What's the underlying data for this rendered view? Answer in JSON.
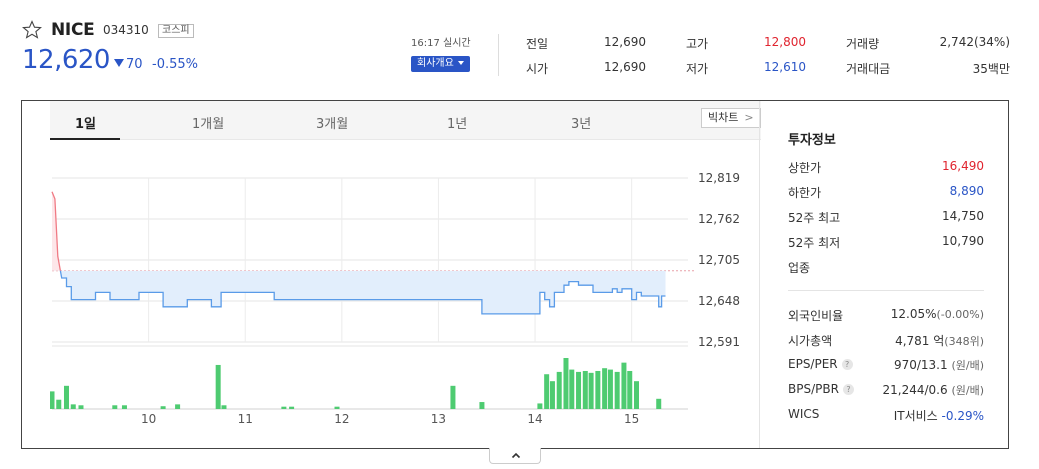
{
  "header": {
    "name": "NICE",
    "code": "034310",
    "market": "코스피",
    "price": "12,620",
    "change": "70",
    "change_pct": "-0.55%",
    "realtime": "16:17 실시간",
    "company_btn": "회사개요"
  },
  "stats": {
    "prev_label": "전일",
    "prev_value": "12,690",
    "open_label": "시가",
    "open_value": "12,690",
    "high_label": "고가",
    "high_value": "12,800",
    "low_label": "저가",
    "low_value": "12,610",
    "volume_label": "거래량",
    "volume_value": "2,742(34%)",
    "amount_label": "거래대금",
    "amount_value": "35백만"
  },
  "tabs": [
    "1일",
    "1개월",
    "3개월",
    "1년",
    "3년"
  ],
  "bigchart_label": "빅차트",
  "info": {
    "title": "투자정보",
    "upper_label": "상한가",
    "upper_value": "16,490",
    "lower_label": "하한가",
    "lower_value": "8,890",
    "high52_label": "52주 최고",
    "high52_value": "14,750",
    "low52_label": "52주 최저",
    "low52_value": "10,790",
    "sector_label": "업종",
    "foreign_label": "외국인비율",
    "foreign_value": "12.05%",
    "foreign_sub": "(-0.00%)",
    "mcap_label": "시가총액",
    "mcap_value": "4,781 억",
    "mcap_sub": "(348위)",
    "eps_label": "EPS/PER",
    "eps_value": "970/13.1",
    "eps_sub": "(원/배)",
    "bps_label": "BPS/PBR",
    "bps_value": "21,244/0.6",
    "bps_sub": "(원/배)",
    "wics_label": "WICS",
    "wics_value": "IT서비스",
    "wics_change": "-0.29%"
  },
  "colors": {
    "up": "#e0242f",
    "down": "#2a55c6",
    "volume": "#4ecb71",
    "line_below": "#5a9be8",
    "line_above": "#f07a84"
  },
  "chart_data": {
    "type": "line",
    "y_ticks": [
      "12,819",
      "12,762",
      "12,705",
      "12,648",
      "12,591"
    ],
    "x_ticks": [
      "10",
      "11",
      "12",
      "13",
      "14",
      "15"
    ],
    "ylim": [
      12591,
      12819
    ],
    "xlim": [
      9.0,
      15.583
    ],
    "prev_close": 12690,
    "price": {
      "t": [
        9.0,
        9.03,
        9.06,
        9.1,
        9.15,
        9.2,
        9.3,
        9.45,
        9.5,
        9.6,
        9.8,
        9.9,
        10.1,
        10.15,
        10.3,
        10.4,
        10.55,
        10.6,
        10.65,
        10.75,
        11.0,
        11.2,
        11.3,
        13.0,
        13.1,
        13.4,
        13.45,
        13.6,
        14.0,
        14.05,
        14.1,
        14.15,
        14.2,
        14.3,
        14.35,
        14.45,
        14.5,
        14.6,
        14.7,
        14.8,
        14.85,
        14.9,
        15.0,
        15.05,
        15.1,
        15.15,
        15.2,
        15.25,
        15.28,
        15.31,
        15.35
      ],
      "v": [
        12800,
        12790,
        12710,
        12680,
        12668,
        12650,
        12650,
        12660,
        12660,
        12650,
        12650,
        12660,
        12660,
        12640,
        12640,
        12650,
        12650,
        12650,
        12640,
        12660,
        12660,
        12660,
        12650,
        12650,
        12650,
        12650,
        12630,
        12630,
        12630,
        12660,
        12650,
        12640,
        12660,
        12670,
        12675,
        12670,
        12670,
        12660,
        12660,
        12665,
        12660,
        12665,
        12650,
        12660,
        12655,
        12655,
        12655,
        12655,
        12640,
        12655,
        12655
      ]
    },
    "volume": {
      "t": [
        9.0,
        9.07,
        9.15,
        9.22,
        9.3,
        9.65,
        9.75,
        10.15,
        10.3,
        10.72,
        10.78,
        11.4,
        11.48,
        11.95,
        13.15,
        13.45,
        14.05,
        14.12,
        14.18,
        14.25,
        14.32,
        14.38,
        14.45,
        14.52,
        14.58,
        14.65,
        14.72,
        14.78,
        14.85,
        14.92,
        14.98,
        15.05,
        15.28
      ],
      "v": [
        38,
        20,
        50,
        10,
        8,
        8,
        8,
        6,
        10,
        95,
        8,
        5,
        5,
        5,
        50,
        15,
        12,
        75,
        60,
        80,
        110,
        85,
        80,
        82,
        78,
        82,
        88,
        85,
        80,
        100,
        82,
        60,
        22
      ]
    }
  }
}
